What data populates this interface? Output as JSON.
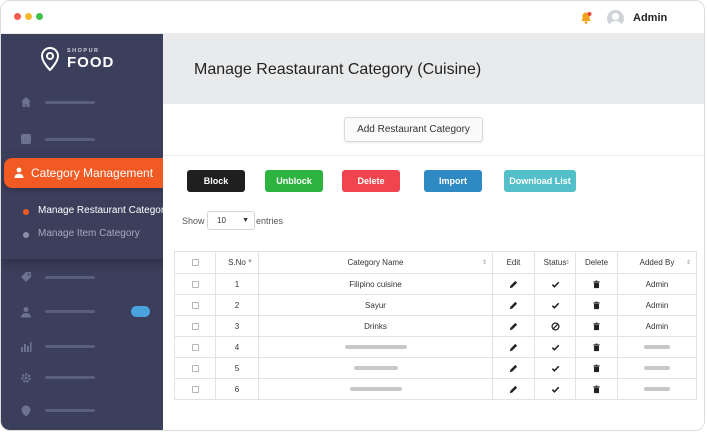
{
  "header": {
    "user_name": "Admin"
  },
  "sidebar": {
    "logo_small": "SHOPUR",
    "logo_big": "FOOD",
    "active_menu": "Category Management",
    "submenu": [
      {
        "label": "Manage Restaurant Category",
        "active": true
      },
      {
        "label": "Manage Item Category",
        "active": false
      }
    ]
  },
  "page": {
    "title": "Manage Reastaurant Category (Cuisine)",
    "add_button": "Add Restaurant Category",
    "actions": {
      "block": "Block",
      "unblock": "Unblock",
      "delete": "Delete",
      "import": "Import",
      "download": "Download List"
    },
    "show_label": "Show",
    "entries_value": "10",
    "entries_label": "entries"
  },
  "table": {
    "columns": [
      "S.No",
      "Category Name",
      "Edit",
      "Status",
      "Delete",
      "Added By"
    ],
    "rows": [
      {
        "sno": "1",
        "name": "Filipino cuisine",
        "status": "active",
        "added_by": "Admin"
      },
      {
        "sno": "2",
        "name": "Sayur",
        "status": "active",
        "added_by": "Admin"
      },
      {
        "sno": "3",
        "name": "Drinks",
        "status": "blocked",
        "added_by": "Admin"
      },
      {
        "sno": "4",
        "name": "",
        "status": "active",
        "added_by": ""
      },
      {
        "sno": "5",
        "name": "",
        "status": "active",
        "added_by": ""
      },
      {
        "sno": "6",
        "name": "",
        "status": "active",
        "added_by": ""
      }
    ]
  },
  "colors": {
    "sidebar": "#3b3f5c",
    "accent": "#f25a24",
    "block": "#1f1f1f",
    "unblock": "#2db33f",
    "delete": "#f0454f",
    "import": "#2f8ac4",
    "download": "#52bfc9"
  }
}
